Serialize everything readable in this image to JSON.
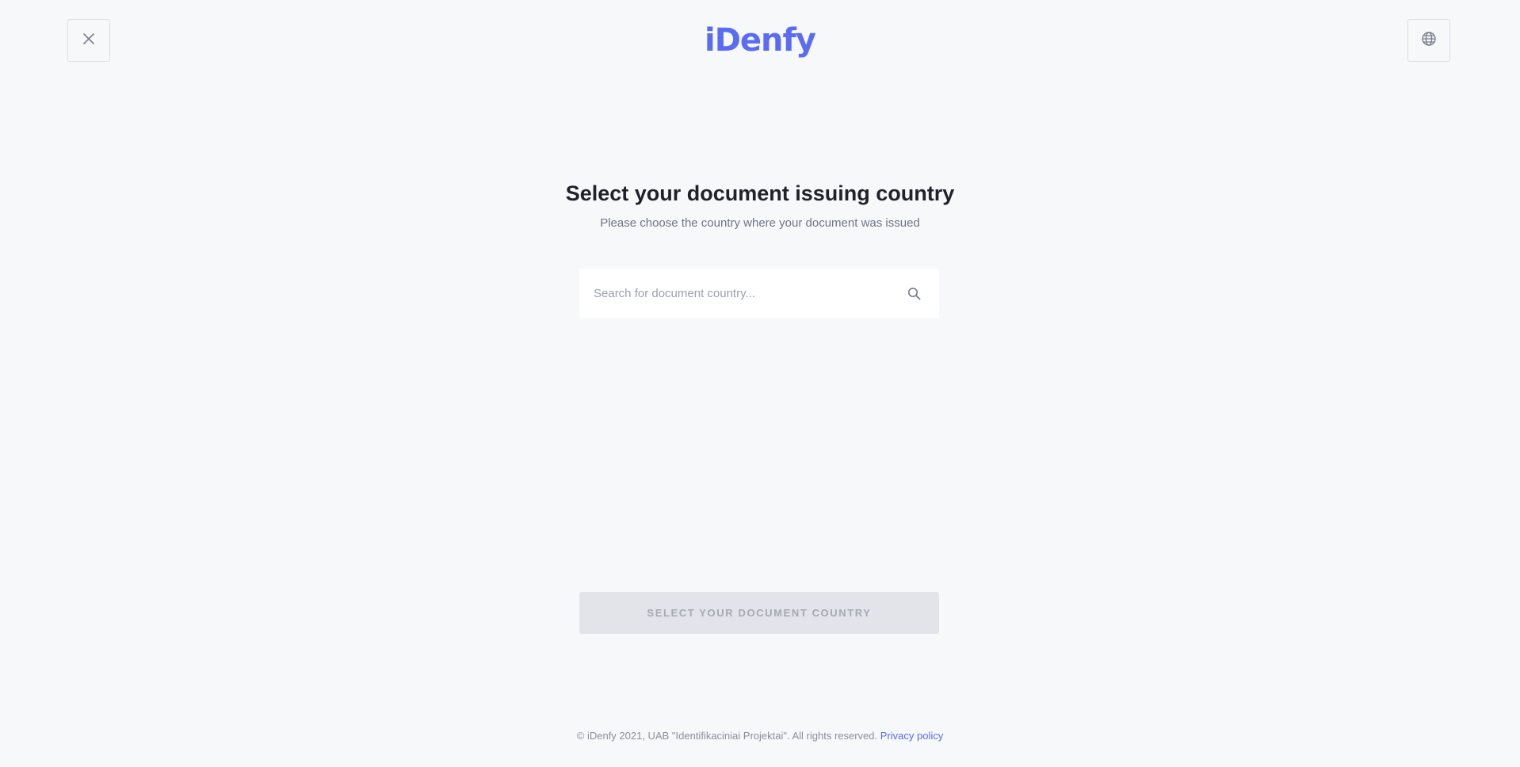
{
  "header": {
    "logo_text": "iDenfy",
    "close_icon": "close-icon",
    "language_icon": "globe-icon"
  },
  "main": {
    "title": "Select your document issuing country",
    "subtitle": "Please choose the country where your document was issued",
    "search": {
      "placeholder": "Search for document country...",
      "value": "",
      "icon": "search-icon"
    },
    "submit_label": "SELECT YOUR DOCUMENT COUNTRY"
  },
  "footer": {
    "copyright": "© iDenfy 2021, UAB \"Identifikaciniai Projektai\". All rights reserved.",
    "privacy_link": "Privacy policy"
  },
  "colors": {
    "brand": "#5a6cf2",
    "background": "#f7f8fa",
    "disabled_button": "#e2e4ea"
  }
}
